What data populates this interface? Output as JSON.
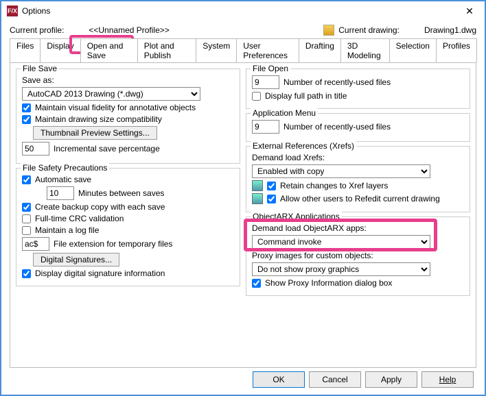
{
  "window": {
    "title": "Options"
  },
  "header": {
    "profileLabel": "Current profile:",
    "profileValue": "<<Unnamed Profile>>",
    "drawingLabel": "Current drawing:",
    "drawingValue": "Drawing1.dwg"
  },
  "tabs": [
    "Files",
    "Display",
    "Open and Save",
    "Plot and Publish",
    "System",
    "User Preferences",
    "Drafting",
    "3D Modeling",
    "Selection",
    "Profiles"
  ],
  "fileSave": {
    "title": "File Save",
    "saveAsLabel": "Save as:",
    "saveAsValue": "AutoCAD 2013 Drawing (*.dwg)",
    "maintainVisual": "Maintain visual fidelity for annotative objects",
    "maintainSize": "Maintain drawing size compatibility",
    "thumbBtn": "Thumbnail Preview Settings...",
    "incValue": "50",
    "incLabel": "Incremental save percentage"
  },
  "safety": {
    "title": "File Safety Precautions",
    "autoSave": "Automatic save",
    "autoMinutes": "10",
    "autoMinutesLabel": "Minutes between saves",
    "backup": "Create backup copy with each save",
    "crc": "Full-time CRC validation",
    "log": "Maintain a log file",
    "extValue": "ac$",
    "extLabel": "File extension for temporary files",
    "digitalBtn": "Digital Signatures...",
    "displayDigital": "Display digital signature information"
  },
  "fileOpen": {
    "title": "File Open",
    "recentValue": "9",
    "recentLabel": "Number of recently-used files",
    "fullPath": "Display full path in title"
  },
  "appMenu": {
    "title": "Application Menu",
    "recentValue": "9",
    "recentLabel": "Number of recently-used files"
  },
  "xrefs": {
    "title": "External References (Xrefs)",
    "demandLabel": "Demand load Xrefs:",
    "demandValue": "Enabled with copy",
    "retain": "Retain changes to Xref layers",
    "allow": "Allow other users to Refedit current drawing"
  },
  "arx": {
    "title": "ObjectARX Applications",
    "demandLabel": "Demand load ObjectARX apps:",
    "demandValue": "Command invoke",
    "proxyLabel": "Proxy images for custom objects:",
    "proxyValue": "Do not show proxy graphics",
    "showProxy": "Show Proxy Information dialog box"
  },
  "buttons": {
    "ok": "OK",
    "cancel": "Cancel",
    "apply": "Apply",
    "help": "Help"
  }
}
